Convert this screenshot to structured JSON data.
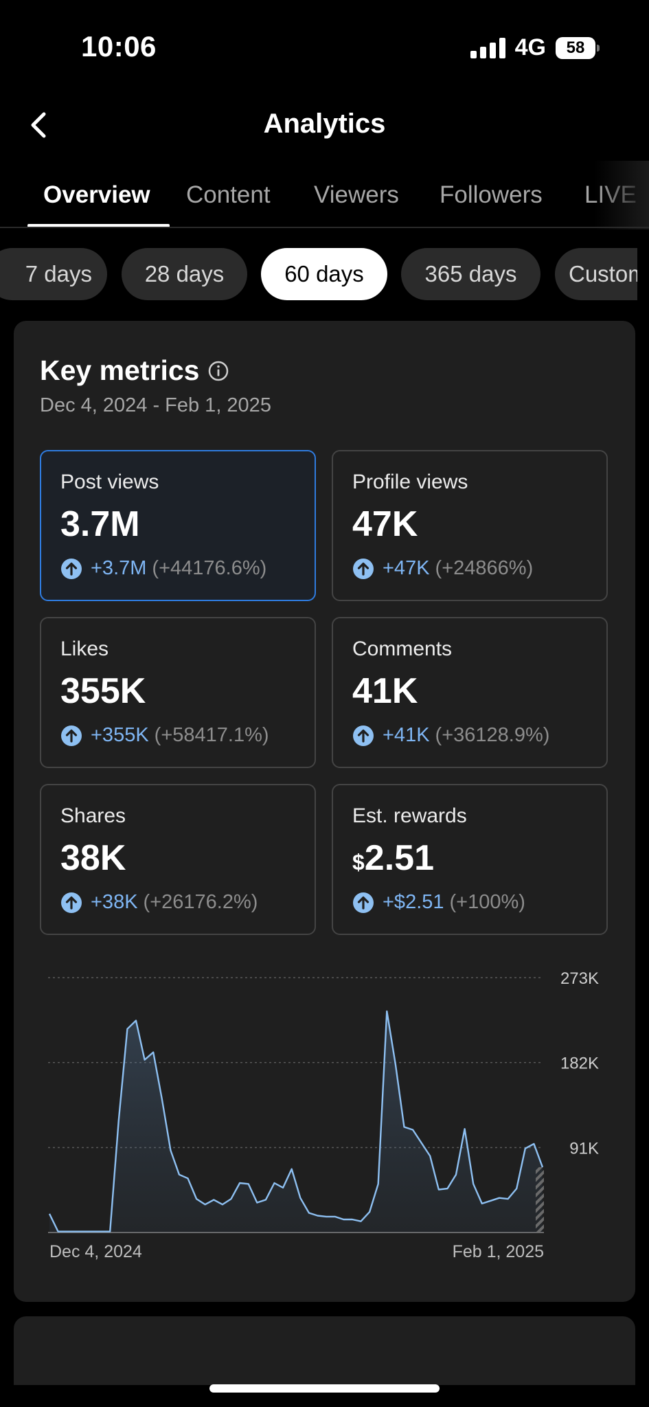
{
  "status_bar": {
    "time": "10:06",
    "network": "4G",
    "battery": "58"
  },
  "header": {
    "title": "Analytics"
  },
  "tabs": [
    {
      "label": "Overview",
      "active": true
    },
    {
      "label": "Content",
      "active": false
    },
    {
      "label": "Viewers",
      "active": false
    },
    {
      "label": "Followers",
      "active": false
    },
    {
      "label": "LIVE",
      "active": false
    }
  ],
  "date_filters": [
    {
      "label": "7 days",
      "active": false
    },
    {
      "label": "28 days",
      "active": false
    },
    {
      "label": "60 days",
      "active": true
    },
    {
      "label": "365 days",
      "active": false
    },
    {
      "label": "Custom",
      "active": false
    }
  ],
  "key_metrics": {
    "title": "Key metrics",
    "date_range": "Dec 4, 2024 - Feb 1, 2025",
    "cards": [
      {
        "label": "Post views",
        "value": "3.7M",
        "currency": "",
        "change": "+3.7M",
        "change_pct": "(+44176.6%)",
        "selected": true
      },
      {
        "label": "Profile views",
        "value": "47K",
        "currency": "",
        "change": "+47K",
        "change_pct": "(+24866%)",
        "selected": false
      },
      {
        "label": "Likes",
        "value": "355K",
        "currency": "",
        "change": "+355K",
        "change_pct": "(+58417.1%)",
        "selected": false
      },
      {
        "label": "Comments",
        "value": "41K",
        "currency": "",
        "change": "+41K",
        "change_pct": "(+36128.9%)",
        "selected": false
      },
      {
        "label": "Shares",
        "value": "38K",
        "currency": "",
        "change": "+38K",
        "change_pct": "(+26176.2%)",
        "selected": false
      },
      {
        "label": "Est. rewards",
        "value": "2.51",
        "currency": "$",
        "change": "+$2.51",
        "change_pct": "(+100%)",
        "selected": false
      }
    ]
  },
  "chart_data": {
    "type": "area",
    "series_color": "#8ec0f2",
    "y_ticks": [
      "273K",
      "182K",
      "91K"
    ],
    "y_tick_values": [
      273000,
      182000,
      91000
    ],
    "ylim": [
      0,
      273000
    ],
    "x_labels": [
      "Dec 4, 2024",
      "Feb 1, 2025"
    ],
    "grid": "dashed",
    "values": [
      20000,
      1000,
      1000,
      1000,
      1000,
      1000,
      1000,
      1000,
      120000,
      218000,
      227000,
      185000,
      193000,
      143000,
      88000,
      62000,
      58000,
      36000,
      30000,
      35000,
      30000,
      36000,
      53000,
      52000,
      32000,
      35000,
      53000,
      48000,
      68000,
      37000,
      21000,
      18000,
      17000,
      17000,
      14000,
      14000,
      12000,
      22000,
      52000,
      237000,
      180000,
      113000,
      110000,
      96000,
      82000,
      46000,
      47000,
      62000,
      111000,
      52000,
      31000,
      34000,
      37000,
      36000,
      47000,
      90000,
      95000,
      70000
    ]
  }
}
